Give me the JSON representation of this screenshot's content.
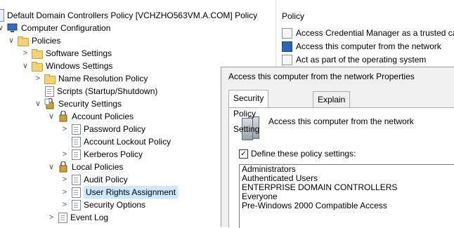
{
  "tree": {
    "items": [
      {
        "label": "Default Domain Controllers Policy [VCHZHO563VM.A.COM] Policy",
        "icon": "gpo-icon",
        "chevron": ""
      },
      {
        "label": "Computer Configuration",
        "icon": "computer-icon",
        "chevron": "∨"
      },
      {
        "label": "Policies",
        "icon": "folder-icon",
        "chevron": "∨"
      },
      {
        "label": "Software Settings",
        "icon": "folder-icon",
        "chevron": ">"
      },
      {
        "label": "Windows Settings",
        "icon": "folder-icon",
        "chevron": "∨"
      },
      {
        "label": "Name Resolution Policy",
        "icon": "folder-icon",
        "chevron": ">"
      },
      {
        "label": "Scripts (Startup/Shutdown)",
        "icon": "script-icon",
        "chevron": ""
      },
      {
        "label": "Security Settings",
        "icon": "security-icon",
        "chevron": "∨"
      },
      {
        "label": "Account Policies",
        "icon": "security-icon",
        "chevron": "∨"
      },
      {
        "label": "Password Policy",
        "icon": "policy-doc-icon",
        "chevron": ">"
      },
      {
        "label": "Account Lockout Policy",
        "icon": "policy-doc-icon",
        "chevron": ""
      },
      {
        "label": "Kerberos Policy",
        "icon": "policy-doc-icon",
        "chevron": ">"
      },
      {
        "label": "Local Policies",
        "icon": "security-icon",
        "chevron": "∨"
      },
      {
        "label": "Audit Policy",
        "icon": "policy-doc-icon",
        "chevron": ">"
      },
      {
        "label": "User Rights Assignment",
        "icon": "policy-doc-icon",
        "chevron": ">",
        "selected": true
      },
      {
        "label": "Security Options",
        "icon": "policy-doc-icon",
        "chevron": ">"
      },
      {
        "label": "Event Log",
        "icon": "policy-doc-icon",
        "chevron": ">"
      }
    ]
  },
  "policy_pane": {
    "header": "Policy",
    "rows": [
      {
        "label": "Access Credential Manager as a trusted calle"
      },
      {
        "label": "Access this computer from the network",
        "selected": true
      },
      {
        "label": "Act as part of the operating system"
      }
    ]
  },
  "dialog": {
    "title": "Access this computer from the network Properties",
    "tabs": [
      "Security Policy Setting",
      "Explain"
    ],
    "policy_name": "Access this computer from the network",
    "define_label": "Define these policy settings:",
    "define_checked": "✓",
    "members": [
      "Administrators",
      "Authenticated Users",
      "ENTERPRISE DOMAIN CONTROLLERS",
      "Everyone",
      "Pre-Windows 2000 Compatible Access"
    ]
  }
}
